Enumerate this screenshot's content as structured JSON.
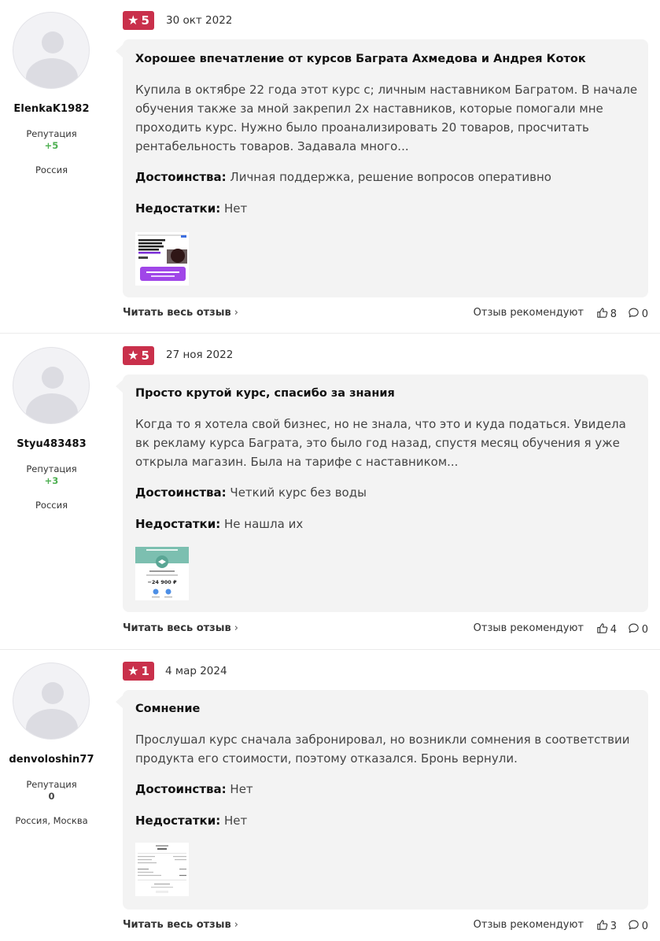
{
  "reviews": [
    {
      "username": "ElenkaK1982",
      "reputation_label": "Репутация",
      "reputation": "+5",
      "location": "Россия",
      "rating": "5",
      "date": "30 окт 2022",
      "title": "Хорошее впечатление от курсов Баграта Ахмедова и Андрея Коток",
      "text": "Купила в октябре 22 года этот курс с; личным наставником Багратом. В начале обучения также за мной закрепил 2х наставников, которые помогали мне проходить курс. Нужно было проанализировать 20 товаров, просчитать рентабельность товаров. Задавала много...",
      "pros_label": "Достоинства:",
      "pros": "Личная поддержка, решение вопросов оперативно",
      "cons_label": "Недостатки:",
      "cons": "Нет",
      "read_all": "Читать весь отзыв",
      "recommend_label": "Отзыв рекомендуют",
      "likes": "8",
      "comments": "0"
    },
    {
      "username": "Styu483483",
      "reputation_label": "Репутация",
      "reputation": "+3",
      "location": "Россия",
      "rating": "5",
      "date": "27 ноя 2022",
      "title": "Просто крутой курс, спасибо за знания",
      "text": "Когда то я хотела свой бизнес, но не знала, что это и куда податься. Увидела вк рекламу курса Баграта, это было год назад, спустя месяц обучения я уже открыла магазин. Была на тарифе с наставником...",
      "pros_label": "Достоинства:",
      "pros": "Четкий курс без воды",
      "cons_label": "Недостатки:",
      "cons": "Не нашла их",
      "thumb_amount": "−24 900 ₽",
      "read_all": "Читать весь отзыв",
      "recommend_label": "Отзыв рекомендуют",
      "likes": "4",
      "comments": "0"
    },
    {
      "username": "denvoloshin77",
      "reputation_label": "Репутация",
      "reputation": "0",
      "location": "Россия, Москва",
      "rating": "1",
      "date": "4 мар 2024",
      "title": "Сомнение",
      "text": "Прослушал курс сначала забронировал, но возникли сомнения в соответствии продукта его стоимости, поэтому отказался. Бронь вернули.",
      "pros_label": "Достоинства:",
      "pros": "Нет",
      "cons_label": "Недостатки:",
      "cons": "Нет",
      "read_all": "Читать весь отзыв",
      "recommend_label": "Отзыв рекомендуют",
      "likes": "3",
      "comments": "0"
    }
  ],
  "icons": {
    "star": "star-icon",
    "like": "thumbs-up-icon",
    "comment": "comment-icon",
    "chevron": "chevron-right-icon"
  },
  "colors": {
    "rating_badge": "#c9304b",
    "reputation_positive": "#4caf50",
    "card_bg": "#f3f3f3"
  }
}
